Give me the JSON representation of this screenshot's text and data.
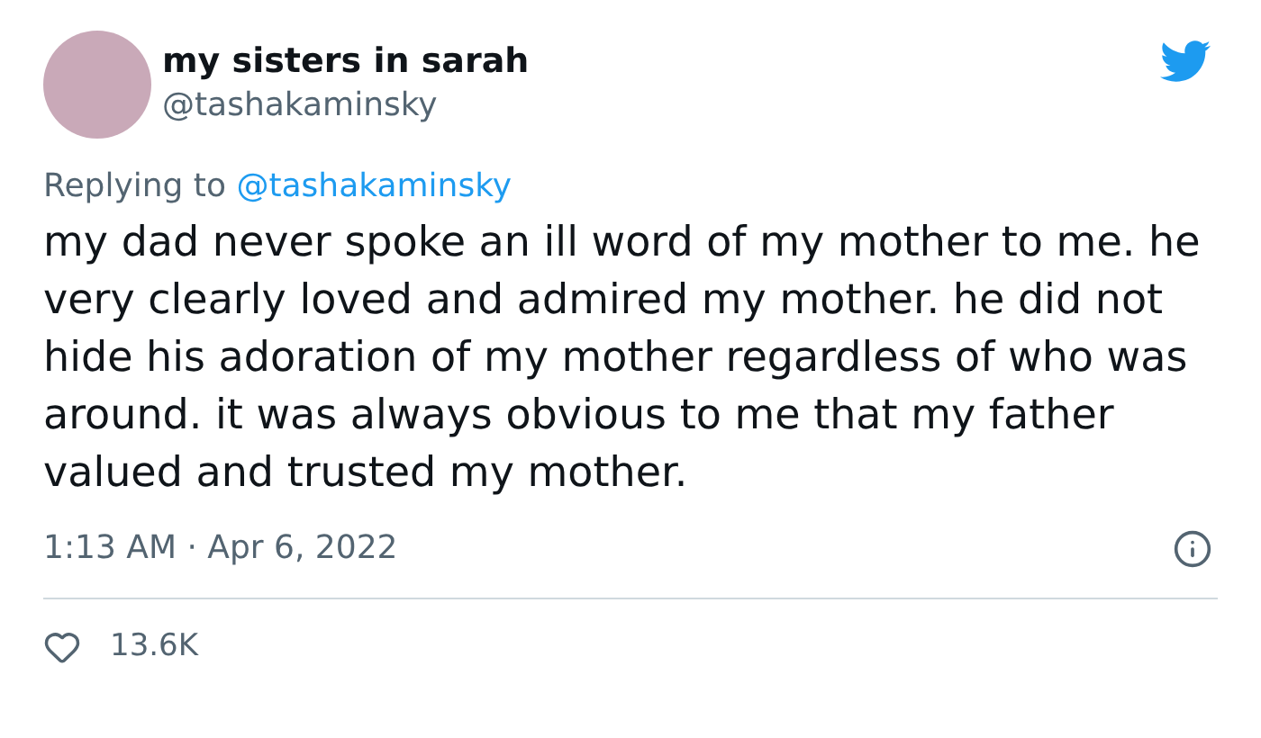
{
  "author": {
    "name": "my sisters in sarah",
    "handle": "@tashakaminsky"
  },
  "reply_to": {
    "label": "Replying to",
    "handle": "@tashakaminsky"
  },
  "text": "my dad never spoke an ill word of my mother to me. he very clearly loved and admired my mother. he did not hide his adoration of my mother regardless of who was around. it was always obvious to me that my father valued and trusted my mother.",
  "timestamp": "1:13 AM · Apr 6, 2022",
  "likes": "13.6K"
}
